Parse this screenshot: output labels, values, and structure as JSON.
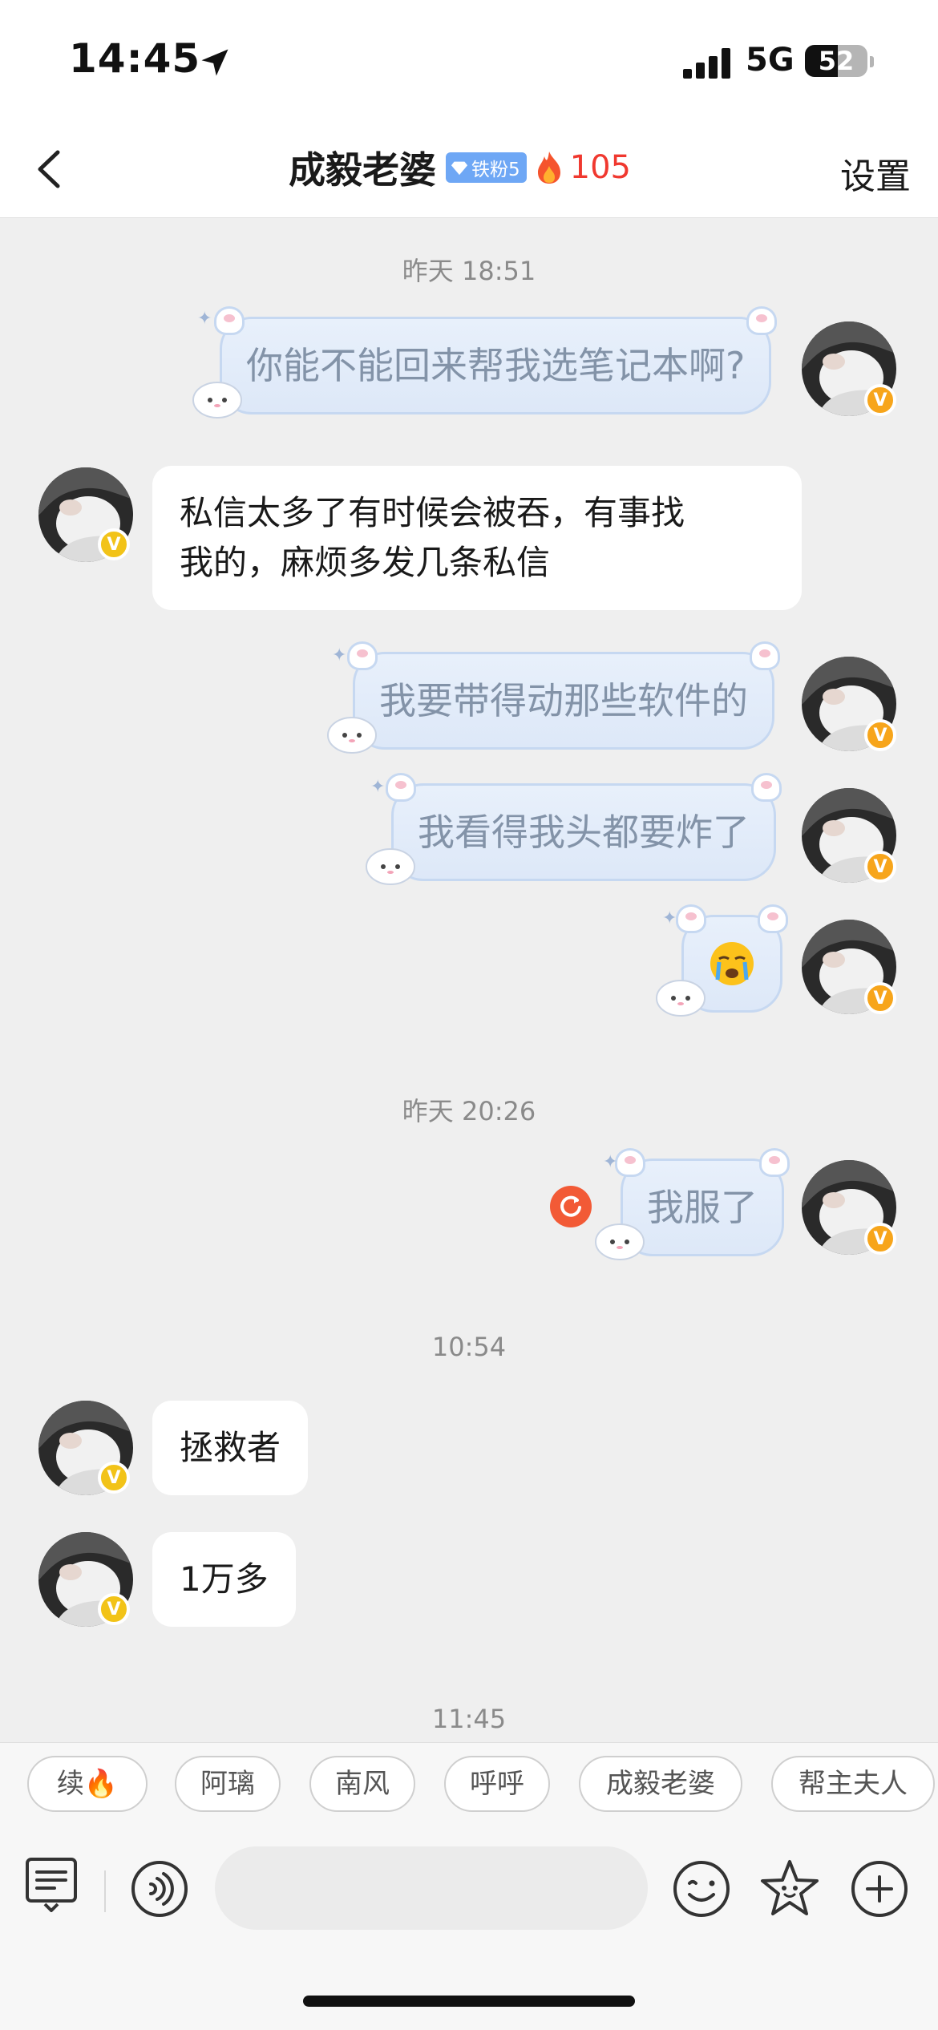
{
  "status_bar": {
    "time": "14:45",
    "network": "5G",
    "battery": "52",
    "battery_level": 0.52
  },
  "header": {
    "back_icon": "chevron-left-icon",
    "title": "成毅老婆",
    "fan_badge": "铁粉5",
    "fire_count": "105",
    "settings": "设置"
  },
  "colors": {
    "accent_red": "#f0382f",
    "fan_badge_blue": "#6ea7f5",
    "bubble_text": "#8393a8",
    "vip_badge": "#f7a51b"
  },
  "messages": {
    "ts1": "昨天 18:51",
    "m1": "你能不能回来帮我选笔记本啊?",
    "m2_line1": "私信太多了有时候会被吞，有事找",
    "m2_line2": "我的，麻烦多发几条私信",
    "m3": "我要带得动那些软件的",
    "m4": "我看得我头都要炸了",
    "m5_emoji": "crying-face-emoji",
    "ts2": "昨天 20:26",
    "m6": "我服了",
    "ts3": "10:54",
    "m7": "拯救者",
    "m8": "1万多",
    "ts4": "11:45",
    "verified_badge": "V"
  },
  "quick_replies": [
    "续🔥",
    "阿璃",
    "南风",
    "呼呼",
    "成毅老婆",
    "帮主夫人"
  ],
  "input_bar": {
    "icons": [
      "keyboard-list-icon",
      "voice-icon",
      "emoji-smile-icon",
      "star-face-icon",
      "plus-icon"
    ],
    "placeholder": ""
  }
}
